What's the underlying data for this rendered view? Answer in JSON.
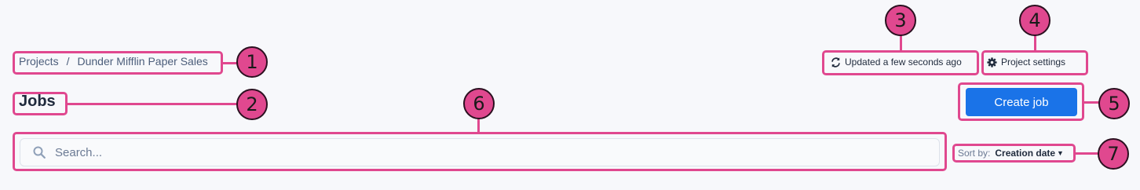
{
  "breadcrumb": {
    "items": [
      "Projects",
      "Dunder Mifflin Paper Sales"
    ],
    "separator": "/"
  },
  "page": {
    "title": "Jobs"
  },
  "header": {
    "updated_text": "Updated a few seconds ago",
    "settings_label": "Project settings",
    "create_button": "Create job"
  },
  "search": {
    "placeholder": "Search...",
    "value": ""
  },
  "sort": {
    "label": "Sort by:",
    "value": "Creation date"
  },
  "annotations": [
    "1",
    "2",
    "3",
    "4",
    "5",
    "6",
    "7"
  ],
  "colors": {
    "annotation": "#e0488f",
    "primary": "#1a73e8",
    "background": "#f7f8fb"
  }
}
